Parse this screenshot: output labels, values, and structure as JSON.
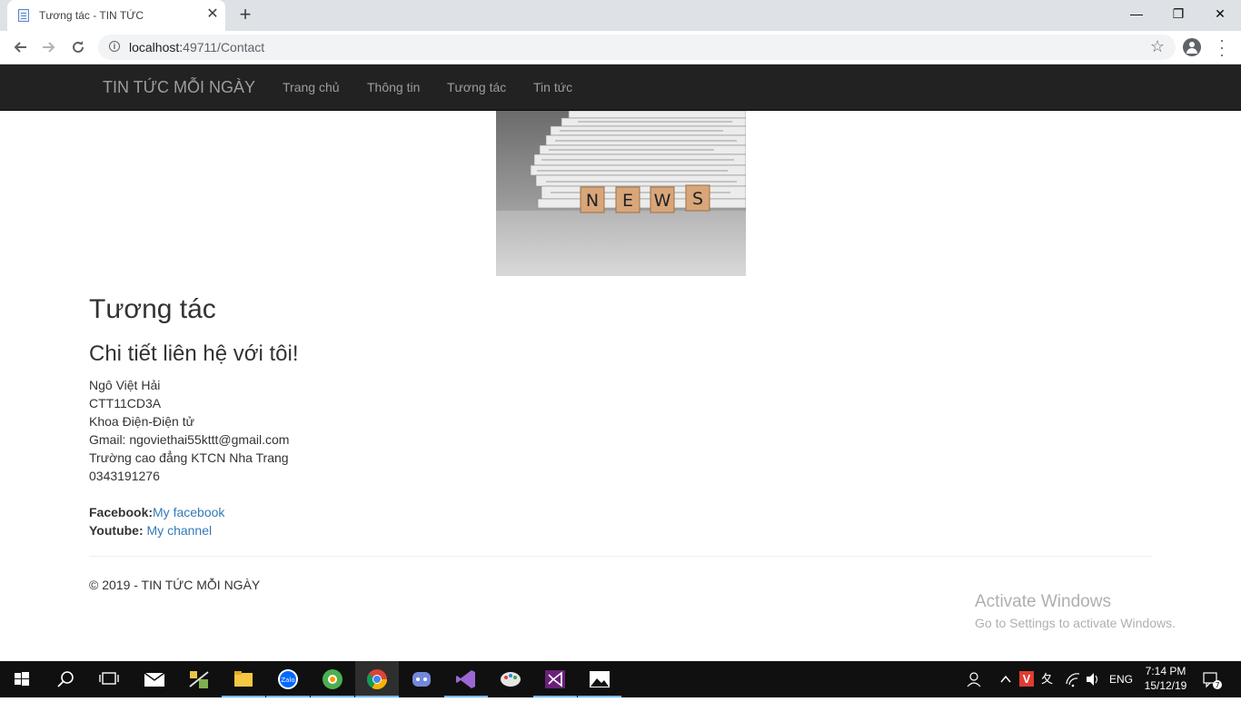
{
  "browser": {
    "tab_title": "Tương tác - TIN TỨC",
    "tab_close": "✕",
    "new_tab": "+",
    "url_host": "localhost:",
    "url_rest": "49711/Contact",
    "window_minimize": "—",
    "window_restore": "❐",
    "window_close": "✕"
  },
  "site": {
    "brand": "TIN TỨC MỖI NGÀY",
    "nav": [
      "Trang chủ",
      "Thông tin",
      "Tương tác",
      "Tin tức"
    ],
    "hero_letters": [
      "N",
      "E",
      "W",
      "S"
    ]
  },
  "page": {
    "title": "Tương tác",
    "subtitle": "Chi tiết liên hệ với tôi!",
    "address_lines": [
      "Ngô Việt Hải",
      "CTT11CD3A",
      "Khoa Điện-Điện tử",
      "Gmail: ngoviethai55kttt@gmail.com",
      "Trường cao đẳng KTCN Nha Trang",
      "0343191276"
    ],
    "facebook_label": "Facebook:",
    "facebook_link": "My facebook",
    "youtube_label": "Youtube:",
    "youtube_link": "My channel",
    "footer": "© 2019 - TIN TỨC MỖI NGÀY"
  },
  "watermark": {
    "line1": "Activate Windows",
    "line2": "Go to Settings to activate Windows."
  },
  "taskbar": {
    "apps": [
      "windows-start",
      "search",
      "task-view",
      "mail",
      "tool",
      "file-explorer",
      "zalo",
      "coccoc",
      "chrome",
      "discord",
      "visual-studio-code",
      "paint",
      "visual-studio",
      "photos"
    ],
    "zalo_text": "Zalo",
    "ime_v": "V",
    "ime_x": "夂",
    "lang": "ENG",
    "time": "7:14 PM",
    "date": "15/12/19",
    "notification_count": "7"
  },
  "colors": {
    "navbar": "#222222",
    "nav_text": "#9d9d9d",
    "link": "#337ab7",
    "taskbar": "#101010"
  }
}
